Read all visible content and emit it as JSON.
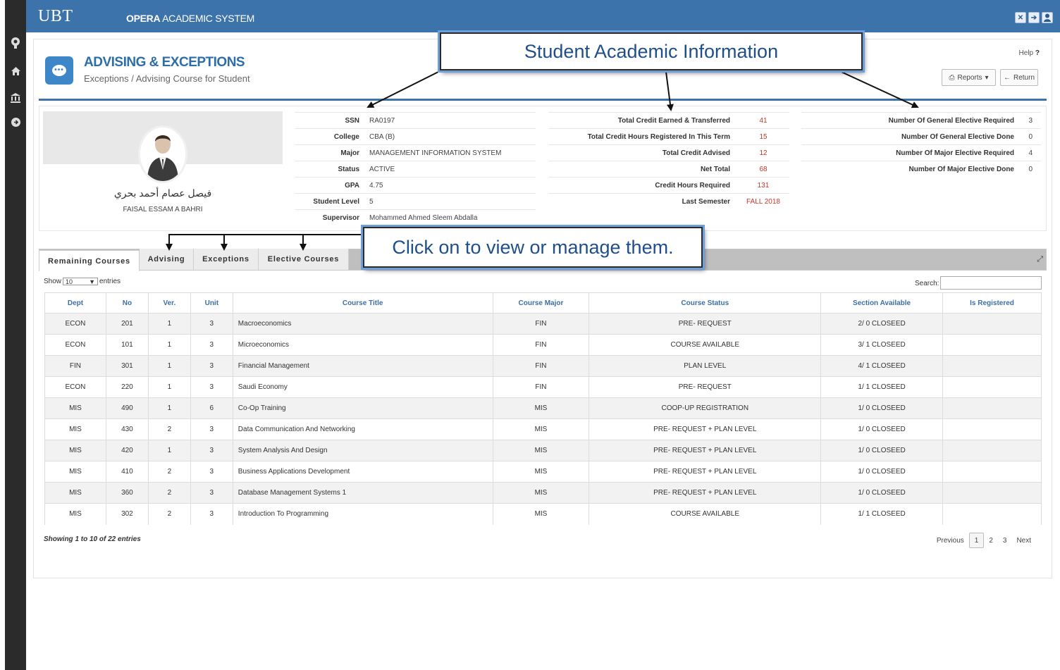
{
  "topbar": {
    "brand": "UBT",
    "system_bold": "OPERA",
    "system_rest": " ACADEMIC SYSTEM",
    "icons": [
      "expand-icon",
      "exit-icon",
      "user-icon"
    ]
  },
  "sidebar": {
    "icons": [
      "logo-icon",
      "home-icon",
      "bank-icon",
      "arrow-right-icon"
    ]
  },
  "header": {
    "title": "ADVISING & EXCEPTIONS",
    "breadcrumb": "Exceptions / Advising Course for Student",
    "help_label": "Help",
    "help_mark": "?",
    "reports_label": "Reports",
    "return_label": "Return"
  },
  "student": {
    "arabic_name": "فيصل عصام أحمد بحري",
    "english_name": "FAISAL ESSAM A BAHRI",
    "info_left": [
      {
        "label": "SSN",
        "value": "RA0197"
      },
      {
        "label": "College",
        "value": "CBA (B)"
      },
      {
        "label": "Major",
        "value": "MANAGEMENT INFORMATION SYSTEM"
      },
      {
        "label": "Status",
        "value": "ACTIVE"
      },
      {
        "label": "GPA",
        "value": "4.75"
      },
      {
        "label": "Student Level",
        "value": "5"
      },
      {
        "label": "Supervisor",
        "value": "Mohammed Ahmed Sleem Abdalla"
      }
    ],
    "info_mid": [
      {
        "label": "Total Credit Earned & Transferred",
        "value": "41"
      },
      {
        "label": "Total Credit Hours Registered In This Term",
        "value": "15"
      },
      {
        "label": "Total Credit Advised",
        "value": "12"
      },
      {
        "label": "Net Total",
        "value": "68"
      },
      {
        "label": "Credit Hours Required",
        "value": "131"
      },
      {
        "label": "Last Semester",
        "value": "FALL 2018"
      }
    ],
    "info_right": [
      {
        "label": "Number Of General Elective Required",
        "value": "3"
      },
      {
        "label": "Number Of General Elective Done",
        "value": "0"
      },
      {
        "label": "Number Of Major Elective Required",
        "value": "4"
      },
      {
        "label": "Number Of Major Elective Done",
        "value": "0"
      }
    ]
  },
  "tabs": [
    {
      "label": "Remaining Courses"
    },
    {
      "label": "Advising"
    },
    {
      "label": "Exceptions"
    },
    {
      "label": "Elective Courses"
    }
  ],
  "table_controls": {
    "show_label": "Show",
    "entries_value": "10",
    "entries_label": "entries",
    "search_label": "Search:"
  },
  "table": {
    "headers": [
      "Dept",
      "No",
      "Ver.",
      "Unit",
      "Course Title",
      "Course Major",
      "Course Status",
      "Section Available",
      "Is Registered"
    ],
    "rows": [
      [
        "ECON",
        "201",
        "1",
        "3",
        "Macroeconomics",
        "FIN",
        "PRE- REQUEST",
        "2/ 0 CLOSEED",
        ""
      ],
      [
        "ECON",
        "101",
        "1",
        "3",
        "Microeconomics",
        "FIN",
        "COURSE AVAILABLE",
        "3/ 1 CLOSEED",
        ""
      ],
      [
        "FIN",
        "301",
        "1",
        "3",
        "Financial Management",
        "FIN",
        "PLAN LEVEL",
        "4/ 1 CLOSEED",
        ""
      ],
      [
        "ECON",
        "220",
        "1",
        "3",
        "Saudi Economy",
        "FIN",
        "PRE- REQUEST",
        "1/ 1 CLOSEED",
        ""
      ],
      [
        "MIS",
        "490",
        "1",
        "6",
        "Co-Op Training",
        "MIS",
        "COOP-UP REGISTRATION",
        "1/ 0 CLOSEED",
        ""
      ],
      [
        "MIS",
        "430",
        "2",
        "3",
        "Data Communication And Networking",
        "MIS",
        "PRE- REQUEST + PLAN LEVEL",
        "1/ 0 CLOSEED",
        ""
      ],
      [
        "MIS",
        "420",
        "1",
        "3",
        "System Analysis And Design",
        "MIS",
        "PRE- REQUEST + PLAN LEVEL",
        "1/ 0 CLOSEED",
        ""
      ],
      [
        "MIS",
        "410",
        "2",
        "3",
        "Business Applications Development",
        "MIS",
        "PRE- REQUEST + PLAN LEVEL",
        "1/ 0 CLOSEED",
        ""
      ],
      [
        "MIS",
        "360",
        "2",
        "3",
        "Database Management Systems 1",
        "MIS",
        "PRE- REQUEST + PLAN LEVEL",
        "1/ 0 CLOSEED",
        ""
      ],
      [
        "MIS",
        "302",
        "2",
        "3",
        "Introduction To Programming",
        "MIS",
        "COURSE AVAILABLE",
        "1/ 1 CLOSEED",
        ""
      ]
    ],
    "summary": "Showing 1 to 10 of 22 entries"
  },
  "pagination": {
    "previous": "Previous",
    "pages": [
      "1",
      "2",
      "3"
    ],
    "current": "1",
    "next": "Next"
  },
  "annotations": {
    "callout_top": "Student Academic Information",
    "callout_tabs": "Click on to view or manage them."
  },
  "colors": {
    "topbar": "#3d73ab",
    "accent": "#2e6ea8",
    "header_icon": "#3d87c9",
    "value_red": "#c0392b",
    "table_header_text": "#3d6fa6"
  }
}
